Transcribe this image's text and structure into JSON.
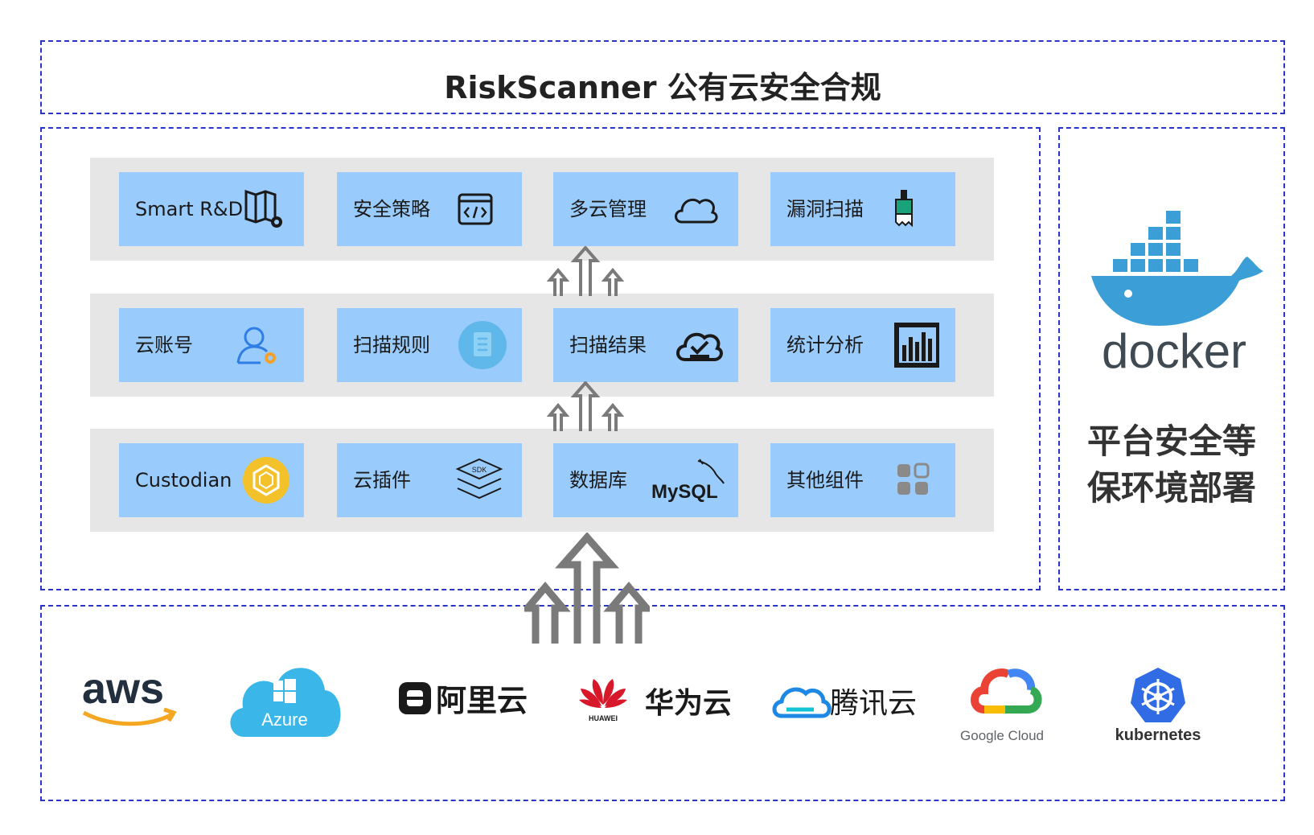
{
  "title": "RiskScanner 公有云安全合规",
  "rows": [
    [
      {
        "label": "Smart R&D",
        "icon": "map-gear-icon"
      },
      {
        "label": "安全策略",
        "icon": "code-window-icon"
      },
      {
        "label": "多云管理",
        "icon": "cloud-icon"
      },
      {
        "label": "漏洞扫描",
        "icon": "paint-brush-icon"
      }
    ],
    [
      {
        "label": "云账号",
        "icon": "user-gear-icon"
      },
      {
        "label": "扫描规则",
        "icon": "document-circle-icon"
      },
      {
        "label": "扫描结果",
        "icon": "cloud-check-icon"
      },
      {
        "label": "统计分析",
        "icon": "bar-chart-icon"
      }
    ],
    [
      {
        "label": "Custodian",
        "icon": "custodian-badge-icon"
      },
      {
        "label": "云插件",
        "icon": "sdk-layers-icon"
      },
      {
        "label": "数据库",
        "icon": "mysql-logo-icon"
      },
      {
        "label": "其他组件",
        "icon": "grid-blocks-icon"
      }
    ]
  ],
  "icon_text": {
    "mysql": "MySQL",
    "sdk": "SDK"
  },
  "docker": {
    "logo_text": "docker",
    "caption_line1": "平台安全等",
    "caption_line2": "保环境部署"
  },
  "clouds": {
    "aws": "aws",
    "azure": "Azure",
    "aliyun": "阿里云",
    "huawei_small": "HUAWEI",
    "huawei": "华为云",
    "tencent": "腾讯云",
    "google": "Google Cloud",
    "kubernetes": "kubernetes"
  },
  "colors": {
    "dashed_border": "#2a35c8",
    "card_bg": "#99ccfc",
    "row_bg": "#e6e6e6",
    "arrow": "#7a7a7a"
  }
}
